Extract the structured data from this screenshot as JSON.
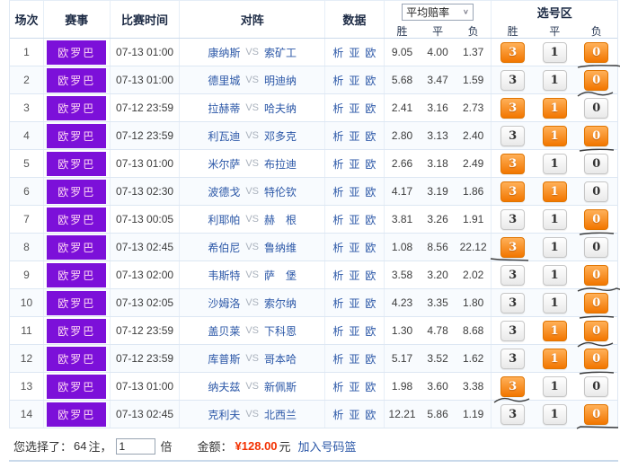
{
  "header": {
    "col_match_no": "场次",
    "col_league": "赛事",
    "col_time": "比赛时间",
    "col_matchup": "对阵",
    "col_data": "数据",
    "odds_group": {
      "select_label": "平均赔率",
      "chevron": "∨",
      "sub": [
        "胜",
        "平",
        "负"
      ]
    },
    "selection_group": {
      "label": "选号区",
      "sub": [
        "胜",
        "平",
        "负"
      ]
    }
  },
  "selection": {
    "button_labels": [
      "3",
      "1",
      "0"
    ]
  },
  "rows": [
    {
      "no": "1",
      "league": "欧罗巴",
      "time": "07-13 01:00",
      "home": "康纳斯",
      "vs": "VS",
      "away": "索矿工",
      "data_links": [
        "析",
        "亚",
        "欧"
      ],
      "odds": [
        "9.05",
        "4.00",
        "1.37"
      ],
      "picks": [
        true,
        false,
        true
      ],
      "marks": {}
    },
    {
      "no": "2",
      "league": "欧罗巴",
      "time": "07-13 01:00",
      "home": "德里城",
      "vs": "VS",
      "away": "明迪纳",
      "data_links": [
        "析",
        "亚",
        "欧"
      ],
      "odds": [
        "5.68",
        "3.47",
        "1.59"
      ],
      "picks": [
        false,
        false,
        true
      ],
      "marks": {
        "m0": "line-long"
      }
    },
    {
      "no": "3",
      "league": "欧罗巴",
      "time": "07-12 23:59",
      "home": "拉赫蒂",
      "vs": "VS",
      "away": "哈夫纳",
      "data_links": [
        "析",
        "亚",
        "欧"
      ],
      "odds": [
        "2.41",
        "3.16",
        "2.73"
      ],
      "picks": [
        true,
        true,
        false
      ],
      "marks": {
        "m0": "squiggle"
      }
    },
    {
      "no": "4",
      "league": "欧罗巴",
      "time": "07-12 23:59",
      "home": "利瓦迪",
      "vs": "VS",
      "away": "邓多克",
      "data_links": [
        "析",
        "亚",
        "欧"
      ],
      "odds": [
        "2.80",
        "3.13",
        "2.40"
      ],
      "picks": [
        false,
        true,
        true
      ],
      "marks": {}
    },
    {
      "no": "5",
      "league": "欧罗巴",
      "time": "07-13 01:00",
      "home": "米尔萨",
      "vs": "VS",
      "away": "布拉迪",
      "data_links": [
        "析",
        "亚",
        "欧"
      ],
      "odds": [
        "2.66",
        "3.18",
        "2.49"
      ],
      "picks": [
        true,
        false,
        false
      ],
      "marks": {
        "m0": "line"
      }
    },
    {
      "no": "6",
      "league": "欧罗巴",
      "time": "07-13 02:30",
      "home": "波德戈",
      "vs": "VS",
      "away": "特伦钦",
      "data_links": [
        "析",
        "亚",
        "欧"
      ],
      "odds": [
        "4.17",
        "3.19",
        "1.86"
      ],
      "picks": [
        true,
        true,
        false
      ],
      "marks": {}
    },
    {
      "no": "7",
      "league": "欧罗巴",
      "time": "07-13 00:05",
      "home": "利耶帕",
      "vs": "VS",
      "away": "赫　根",
      "data_links": [
        "析",
        "亚",
        "欧"
      ],
      "odds": [
        "3.81",
        "3.26",
        "1.91"
      ],
      "picks": [
        false,
        false,
        true
      ],
      "marks": {}
    },
    {
      "no": "8",
      "league": "欧罗巴",
      "time": "07-13 02:45",
      "home": "希伯尼",
      "vs": "VS",
      "away": "鲁纳维",
      "data_links": [
        "析",
        "亚",
        "欧"
      ],
      "odds": [
        "1.08",
        "8.56",
        "22.12"
      ],
      "picks": [
        true,
        false,
        false
      ],
      "marks": {
        "m0": "line",
        "m3": "underline"
      }
    },
    {
      "no": "9",
      "league": "欧罗巴",
      "time": "07-13 02:00",
      "home": "韦斯特",
      "vs": "VS",
      "away": "萨　堡",
      "data_links": [
        "析",
        "亚",
        "欧"
      ],
      "odds": [
        "3.58",
        "3.20",
        "2.02"
      ],
      "picks": [
        false,
        false,
        true
      ],
      "marks": {}
    },
    {
      "no": "10",
      "league": "欧罗巴",
      "time": "07-13 02:05",
      "home": "沙姆洛",
      "vs": "VS",
      "away": "索尔纳",
      "data_links": [
        "析",
        "亚",
        "欧"
      ],
      "odds": [
        "4.23",
        "3.35",
        "1.80"
      ],
      "picks": [
        false,
        false,
        true
      ],
      "marks": {
        "m0": "squiggle-long"
      }
    },
    {
      "no": "11",
      "league": "欧罗巴",
      "time": "07-12 23:59",
      "home": "盖贝莱",
      "vs": "VS",
      "away": "下科恩",
      "data_links": [
        "析",
        "亚",
        "欧"
      ],
      "odds": [
        "1.30",
        "4.78",
        "8.68"
      ],
      "picks": [
        false,
        true,
        true
      ],
      "marks": {
        "m0": "line"
      }
    },
    {
      "no": "12",
      "league": "欧罗巴",
      "time": "07-12 23:59",
      "home": "库普斯",
      "vs": "VS",
      "away": "哥本哈",
      "data_links": [
        "析",
        "亚",
        "欧"
      ],
      "odds": [
        "5.17",
        "3.52",
        "1.62"
      ],
      "picks": [
        false,
        true,
        true
      ],
      "marks": {
        "m0": "squiggle"
      }
    },
    {
      "no": "13",
      "league": "欧罗巴",
      "time": "07-13 01:00",
      "home": "纳夫兹",
      "vs": "VS",
      "away": "新佩斯",
      "data_links": [
        "析",
        "亚",
        "欧"
      ],
      "odds": [
        "1.98",
        "3.60",
        "3.38"
      ],
      "picks": [
        true,
        false,
        false
      ],
      "marks": {
        "m0": "line"
      }
    },
    {
      "no": "14",
      "league": "欧罗巴",
      "time": "07-13 02:45",
      "home": "克利夫",
      "vs": "VS",
      "away": "北西兰",
      "data_links": [
        "析",
        "亚",
        "欧"
      ],
      "odds": [
        "12.21",
        "5.86",
        "1.19"
      ],
      "picks": [
        false,
        false,
        true
      ],
      "marks": {
        "m3": "squiggle"
      }
    }
  ],
  "footer": {
    "selected_prefix": "您选择了：",
    "bet_count": "64",
    "bet_unit": "注，",
    "multiplier_value": "1",
    "multiplier_unit": "倍",
    "amount_label": "金额：",
    "amount": "¥128.00",
    "amount_unit": "元",
    "add_to_basket": "加入号码篮"
  },
  "colors": {
    "league_badge_purple": "#7c10d9",
    "selected_button_orange": "#f27600",
    "link_blue": "#2b57a7",
    "amount_red": "#f33000"
  }
}
